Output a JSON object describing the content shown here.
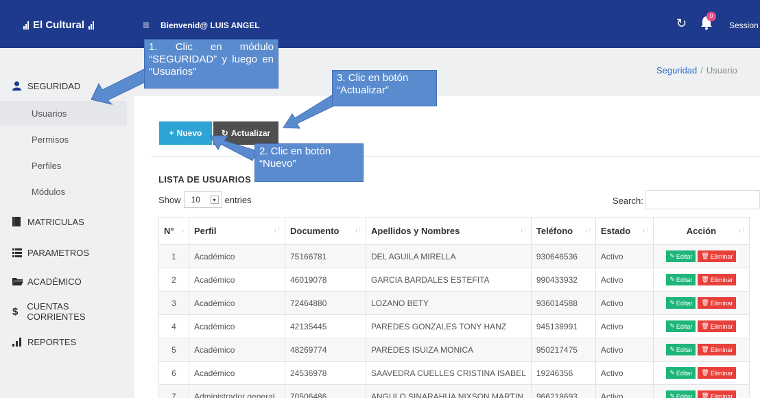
{
  "header": {
    "brand": "El Cultural",
    "welcome": "Bienvenid@ LUIS ANGEL",
    "notification_count": "0",
    "session_label": "Session",
    "menu_icon": "hamburger-icon",
    "refresh_icon": "refresh-icon",
    "bell_icon": "bell-icon"
  },
  "breadcrumb": {
    "parent": "Seguridad",
    "separator": "/",
    "current": "Usuario"
  },
  "sidebar": {
    "items": [
      {
        "label": "SEGURIDAD",
        "icon": "user-icon"
      },
      {
        "label": "MATRICULAS",
        "icon": "book-icon"
      },
      {
        "label": "PARAMETROS",
        "icon": "list-icon"
      },
      {
        "label": "ACADÉMICO",
        "icon": "folder-icon"
      },
      {
        "label": "CUENTAS CORRIENTES",
        "icon": "dollar-icon"
      },
      {
        "label": "REPORTES",
        "icon": "bar-chart-icon"
      }
    ],
    "subitems": [
      {
        "label": "Usuarios"
      },
      {
        "label": "Permisos"
      },
      {
        "label": "Perfiles"
      },
      {
        "label": "Módulos"
      }
    ]
  },
  "toolbar": {
    "new_label": "Nuevo",
    "new_prefix": "+",
    "refresh_label": "Actualizar"
  },
  "list": {
    "title": "LISTA DE USUARIOS",
    "show_label": "Show",
    "entries_value": "10",
    "entries_label": "entries",
    "search_label": "Search:"
  },
  "table": {
    "headers": [
      "N°",
      "Perfil",
      "Documento",
      "Apellidos y Nombres",
      "Teléfono",
      "Estado",
      "Acción"
    ],
    "edit_label": "Editar",
    "delete_label": "Eliminar",
    "rows": [
      {
        "n": "1",
        "perfil": "Académico",
        "documento": "75166781",
        "nombre": "DEL AGUILA MIRELLA",
        "telefono": "930646536",
        "estado": "Activo"
      },
      {
        "n": "2",
        "perfil": "Académico",
        "documento": "46019078",
        "nombre": "GARCIA BARDALES ESTEFITA",
        "telefono": "990433932",
        "estado": "Activo"
      },
      {
        "n": "3",
        "perfil": "Académico",
        "documento": "72464880",
        "nombre": "LOZANO BETY",
        "telefono": "936014588",
        "estado": "Activo"
      },
      {
        "n": "4",
        "perfil": "Académico",
        "documento": "42135445",
        "nombre": "PAREDES GONZALES TONY HANZ",
        "telefono": "945138991",
        "estado": "Activo"
      },
      {
        "n": "5",
        "perfil": "Académico",
        "documento": "48269774",
        "nombre": "PAREDES ISUIZA MONICA",
        "telefono": "950217475",
        "estado": "Activo"
      },
      {
        "n": "6",
        "perfil": "Académico",
        "documento": "24536978",
        "nombre": "SAAVEDRA CUELLES CRISTINA ISABEL",
        "telefono": "19246356",
        "estado": "Activo"
      },
      {
        "n": "7",
        "perfil": "Administrador general",
        "documento": "70506486",
        "nombre": "ANGULO SINARAHUA NIXSON MARTIN",
        "telefono": "966218693",
        "estado": "Activo"
      }
    ]
  },
  "callouts": {
    "step1": "1. Clic en módulo “SEGURIDAD” y luego en “Usuarios”",
    "step2": "2. Clic en botón “Nuevo”",
    "step3": "3. Clic en botón “Actualizar”"
  },
  "colors": {
    "topbar": "#1e3a8c",
    "new_button": "#2ea4d4",
    "refresh_button": "#4f4f4f",
    "edit_button": "#1fb57a",
    "delete_button": "#e7403b",
    "callout": "#5b8bcf"
  }
}
